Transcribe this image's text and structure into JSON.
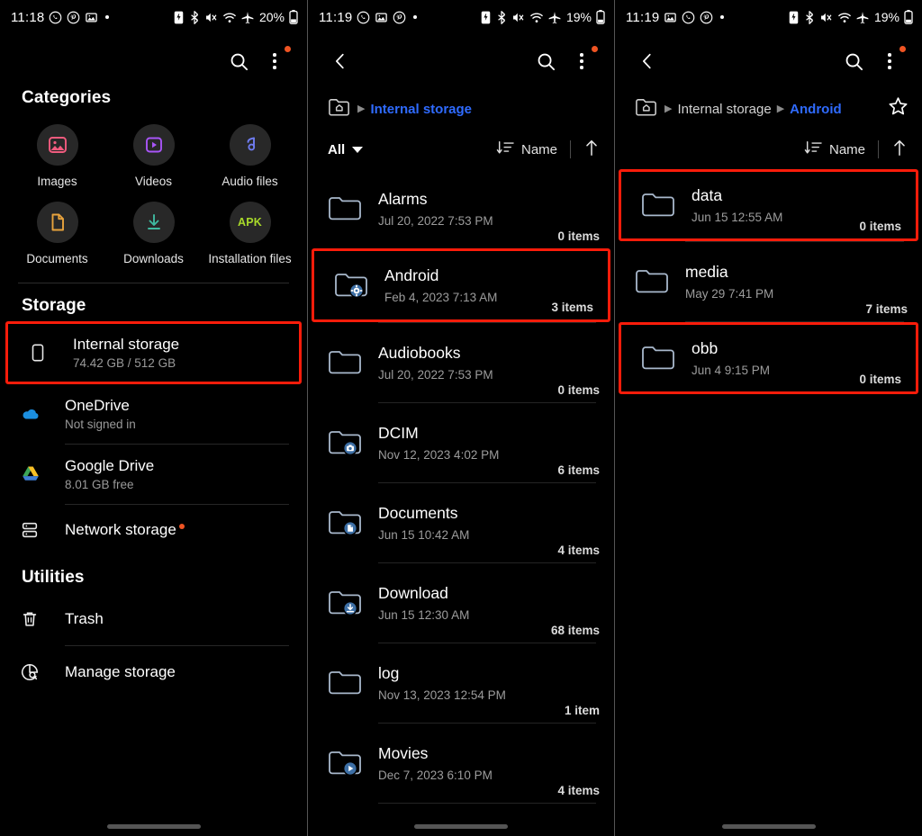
{
  "panels": [
    {
      "status_bar": {
        "time": "11:18",
        "left_icons": [
          "whatsapp-icon",
          "pinterest-icon",
          "gallery-icon",
          "dot-icon"
        ],
        "right_icons": [
          "sim-icon",
          "bluetooth-icon",
          "mute-icon",
          "wifi-icon",
          "airplane-icon"
        ],
        "battery": "20%"
      },
      "appbar": {
        "search_label": "search-icon",
        "menu_label": "more-options-icon",
        "has_badge": true
      },
      "categories": {
        "title": "Categories",
        "items": [
          {
            "label": "Images",
            "icon": "image-icon",
            "color": "#f15b7e"
          },
          {
            "label": "Videos",
            "icon": "video-icon",
            "color": "#a855f7"
          },
          {
            "label": "Audio files",
            "icon": "music-note-icon",
            "color": "#6f7cf0"
          },
          {
            "label": "Documents",
            "icon": "document-icon",
            "color": "#e8a33d"
          },
          {
            "label": "Downloads",
            "icon": "download-icon",
            "color": "#3fb9a0"
          },
          {
            "label": "Installation files",
            "icon": "apk-icon",
            "color": "#a8d92a",
            "badge_text": "APK"
          }
        ]
      },
      "storage": {
        "title": "Storage",
        "items": [
          {
            "label": "Internal storage",
            "sub": "74.42 GB / 512 GB",
            "icon": "phone-icon",
            "highlighted": true
          },
          {
            "label": "OneDrive",
            "sub": "Not signed in",
            "icon": "onedrive-icon",
            "highlighted": false
          },
          {
            "label": "Google Drive",
            "sub": "8.01 GB free",
            "icon": "google-drive-icon",
            "highlighted": false
          },
          {
            "label": "Network storage",
            "sub": "",
            "icon": "server-icon",
            "highlighted": false,
            "dot": true
          }
        ]
      },
      "utilities": {
        "title": "Utilities",
        "items": [
          {
            "label": "Trash",
            "icon": "trash-icon"
          },
          {
            "label": "Manage storage",
            "icon": "storage-analysis-icon"
          }
        ]
      }
    },
    {
      "status_bar": {
        "time": "11:19",
        "left_icons": [
          "whatsapp-icon",
          "gallery-icon",
          "pinterest-icon",
          "dot-icon"
        ],
        "right_icons": [
          "sim-icon",
          "bluetooth-icon",
          "mute-icon",
          "wifi-icon",
          "airplane-icon"
        ],
        "battery": "19%"
      },
      "appbar": {
        "back_label": "back-icon",
        "search_label": "search-icon",
        "menu_label": "more-options-icon",
        "has_badge": true
      },
      "breadcrumb": {
        "home_icon": "home-folder-icon",
        "segments": [
          {
            "label": "Internal storage",
            "current": true
          }
        ],
        "star": false
      },
      "sortbar": {
        "filter": "All",
        "sort_by": "Name",
        "direction": "ascending"
      },
      "files": [
        {
          "name": "Alarms",
          "date": "Jul 20, 2022 7:53 PM",
          "count": "0 items",
          "badge": "none",
          "highlighted": false
        },
        {
          "name": "Android",
          "date": "Feb 4, 2023 7:13 AM",
          "count": "3 items",
          "badge": "gear",
          "highlighted": true
        },
        {
          "name": "Audiobooks",
          "date": "Jul 20, 2022 7:53 PM",
          "count": "0 items",
          "badge": "none",
          "highlighted": false
        },
        {
          "name": "DCIM",
          "date": "Nov 12, 2023 4:02 PM",
          "count": "6 items",
          "badge": "camera",
          "highlighted": false
        },
        {
          "name": "Documents",
          "date": "Jun 15 10:42 AM",
          "count": "4 items",
          "badge": "document",
          "highlighted": false
        },
        {
          "name": "Download",
          "date": "Jun 15 12:30 AM",
          "count": "68 items",
          "badge": "download",
          "highlighted": false
        },
        {
          "name": "log",
          "date": "Nov 13, 2023 12:54 PM",
          "count": "1 item",
          "badge": "none",
          "highlighted": false
        },
        {
          "name": "Movies",
          "date": "Dec 7, 2023 6:10 PM",
          "count": "4 items",
          "badge": "play",
          "highlighted": false
        }
      ]
    },
    {
      "status_bar": {
        "time": "11:19",
        "left_icons": [
          "gallery-icon",
          "whatsapp-icon",
          "pinterest-icon",
          "dot-icon"
        ],
        "right_icons": [
          "sim-icon",
          "bluetooth-icon",
          "mute-icon",
          "wifi-icon",
          "airplane-icon"
        ],
        "battery": "19%"
      },
      "appbar": {
        "back_label": "back-icon",
        "search_label": "search-icon",
        "menu_label": "more-options-icon",
        "has_badge": true
      },
      "breadcrumb": {
        "home_icon": "home-folder-icon",
        "segments": [
          {
            "label": "Internal storage",
            "current": false
          },
          {
            "label": "Android",
            "current": true
          }
        ],
        "star": true
      },
      "sortbar": {
        "sort_by": "Name",
        "direction": "ascending"
      },
      "files": [
        {
          "name": "data",
          "date": "Jun 15 12:55 AM",
          "count": "0 items",
          "badge": "none",
          "highlighted": true
        },
        {
          "name": "media",
          "date": "May 29 7:41 PM",
          "count": "7 items",
          "badge": "none",
          "highlighted": false
        },
        {
          "name": "obb",
          "date": "Jun 4 9:15 PM",
          "count": "0 items",
          "badge": "none",
          "highlighted": true
        }
      ]
    }
  ],
  "colors": {
    "highlight": "#fb1c0a",
    "accent_blue": "#2f6bff",
    "badge_orange": "#ef5423",
    "folder_stroke": "#a8b8cc",
    "folder_badge": "#3d6fa5"
  }
}
